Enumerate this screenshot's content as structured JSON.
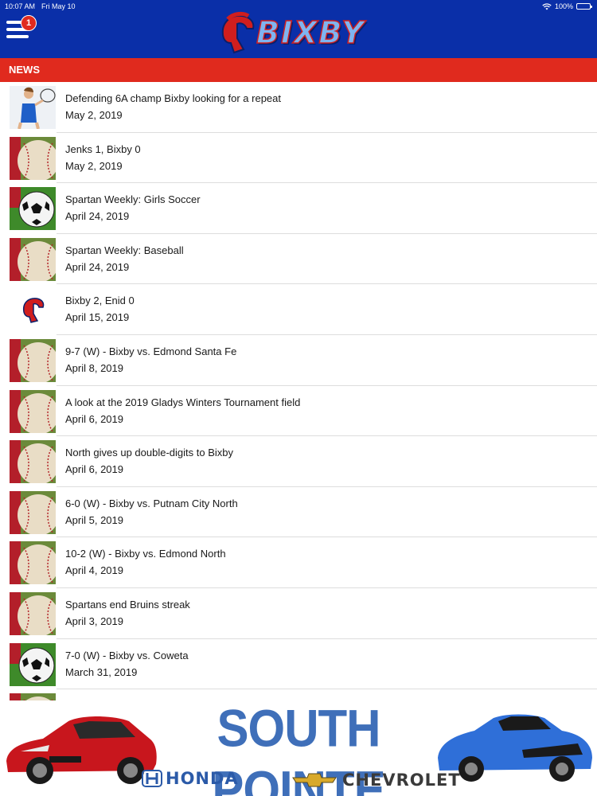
{
  "status_bar": {
    "time": "10:07 AM",
    "date": "Fri May 10",
    "battery": "100%",
    "battery_level": 1.0
  },
  "header": {
    "logo_text": "BIXBY",
    "menu_badge": "1",
    "colors": {
      "background": "#0a2fa8",
      "badge": "#e02a1e"
    }
  },
  "section": {
    "title": "NEWS",
    "color": "#e02a1e"
  },
  "news": [
    {
      "title": "Defending 6A champ Bixby looking for a repeat",
      "date": "May 2, 2019",
      "thumb": "tennis-player"
    },
    {
      "title": "Jenks 1, Bixby 0",
      "date": "May 2, 2019",
      "thumb": "baseball"
    },
    {
      "title": "Spartan Weekly: Girls Soccer",
      "date": "April 24, 2019",
      "thumb": "soccer-ball"
    },
    {
      "title": "Spartan Weekly: Baseball",
      "date": "April 24, 2019",
      "thumb": "baseball"
    },
    {
      "title": "Bixby 2, Enid 0",
      "date": "April 15, 2019",
      "thumb": "spartan-logo"
    },
    {
      "title": "9-7 (W) - Bixby vs. Edmond Santa Fe",
      "date": "April 8, 2019",
      "thumb": "baseball"
    },
    {
      "title": "A look at the 2019 Gladys Winters Tournament field",
      "date": "April 6, 2019",
      "thumb": "baseball"
    },
    {
      "title": "North gives up double-digits to Bixby",
      "date": "April 6, 2019",
      "thumb": "baseball"
    },
    {
      "title": "6-0 (W) - Bixby vs. Putnam City North",
      "date": "April 5, 2019",
      "thumb": "baseball"
    },
    {
      "title": "10-2 (W) - Bixby vs. Edmond North",
      "date": "April 4, 2019",
      "thumb": "baseball"
    },
    {
      "title": "Spartans end Bruins streak",
      "date": "April 3, 2019",
      "thumb": "baseball"
    },
    {
      "title": "7-0 (W) - Bixby vs. Coweta",
      "date": "March 31, 2019",
      "thumb": "soccer-ball"
    }
  ],
  "ad": {
    "title": "SOUTH POINTE",
    "brand_left": "HONDA",
    "brand_right": "CHEVROLET",
    "colors": {
      "title": "#3f6fb9",
      "car_left": "#c8161d",
      "car_right": "#2f6fd8"
    }
  }
}
